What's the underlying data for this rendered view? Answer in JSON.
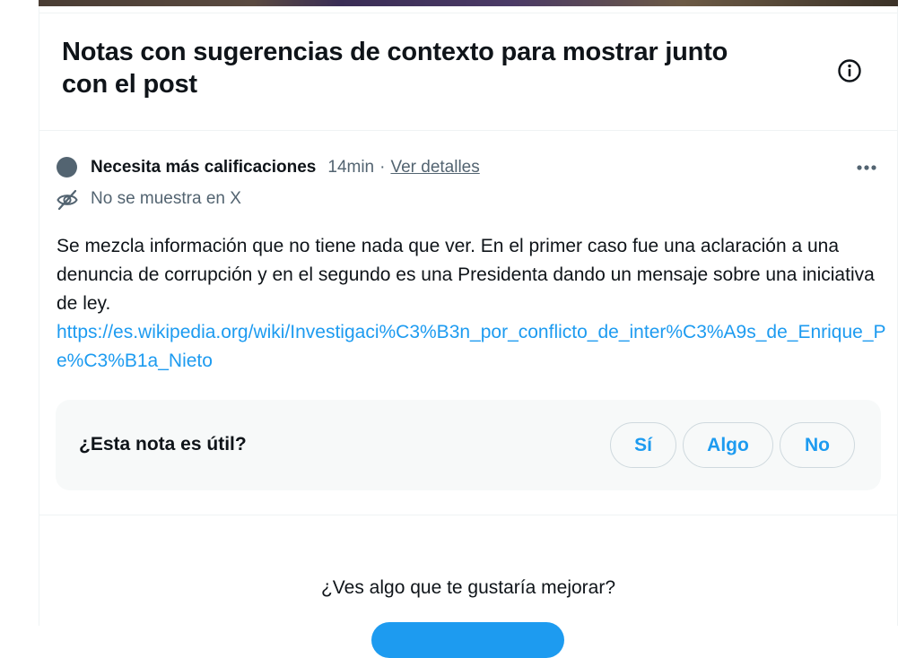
{
  "header": {
    "title": "Notas con sugerencias de contexto para mostrar junto con el post",
    "info_icon": "info-circle-icon"
  },
  "note": {
    "status_icon": "status-dot",
    "status_color": "#536471",
    "status_label": "Necesita más calificaciones",
    "time": "14min",
    "separator": "·",
    "details_link": "Ver detalles",
    "more_icon": "more-horizontal-icon",
    "visibility_icon": "eye-off-icon",
    "visibility_text": "No se muestra en X",
    "body_text": "Se mezcla información que no tiene nada que ver. En el primer caso fue una aclaración a una denuncia de corrupción y en el segundo es una Presidenta dando un mensaje sobre una iniciativa de ley.",
    "body_link": "https://es.wikipedia.org/wiki/Investigaci%C3%B3n_por_conflicto_de_inter%C3%A9s_de_Enrique_Pe%C3%B1a_Nieto"
  },
  "rating": {
    "question": "¿Esta nota es útil?",
    "yes_label": "Sí",
    "somewhat_label": "Algo",
    "no_label": "No"
  },
  "feedback": {
    "prompt": "¿Ves algo que te gustaría mejorar?"
  },
  "colors": {
    "accent": "#1d9bf0",
    "text_primary": "#0f1419",
    "text_secondary": "#536471",
    "panel_bg": "#f7f9f9"
  }
}
